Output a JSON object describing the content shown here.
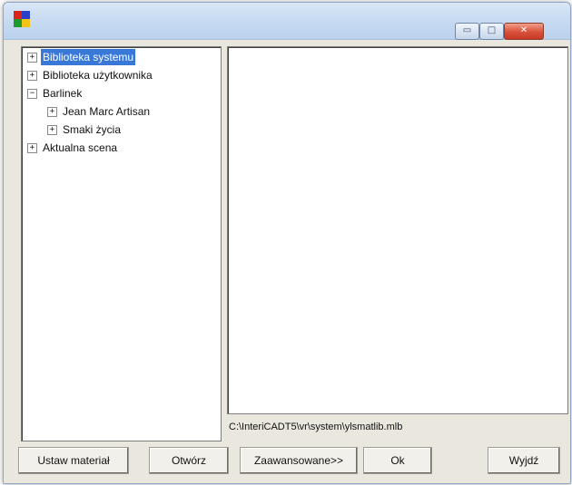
{
  "window": {
    "minimize_glyph": "▭",
    "maximize_glyph": "□",
    "close_glyph": "✕"
  },
  "tree": {
    "items": [
      {
        "label": "Biblioteka systemu",
        "expander": "+",
        "level": 0,
        "selected": true
      },
      {
        "label": "Biblioteka użytkownika",
        "expander": "+",
        "level": 0,
        "selected": false
      },
      {
        "label": "Barlinek",
        "expander": "−",
        "level": 0,
        "selected": false
      },
      {
        "label": "Jean Marc Artisan",
        "expander": "+",
        "level": 1,
        "selected": false
      },
      {
        "label": "Smaki życia",
        "expander": "+",
        "level": 1,
        "selected": false
      },
      {
        "label": "Aktualna scena",
        "expander": "+",
        "level": 0,
        "selected": false
      }
    ]
  },
  "status": {
    "path": "C:\\InteriCADT5\\vr\\system\\ylsmatlib.mlb"
  },
  "buttons": {
    "set_material": "Ustaw materiał",
    "open": "Otwórz",
    "advanced": "Zaawansowane>>",
    "ok": "Ok",
    "exit": "Wyjdź"
  },
  "colors": {
    "selection": "#3a78d8",
    "close_button": "#d9503a",
    "window_background": "#e9e7de"
  }
}
